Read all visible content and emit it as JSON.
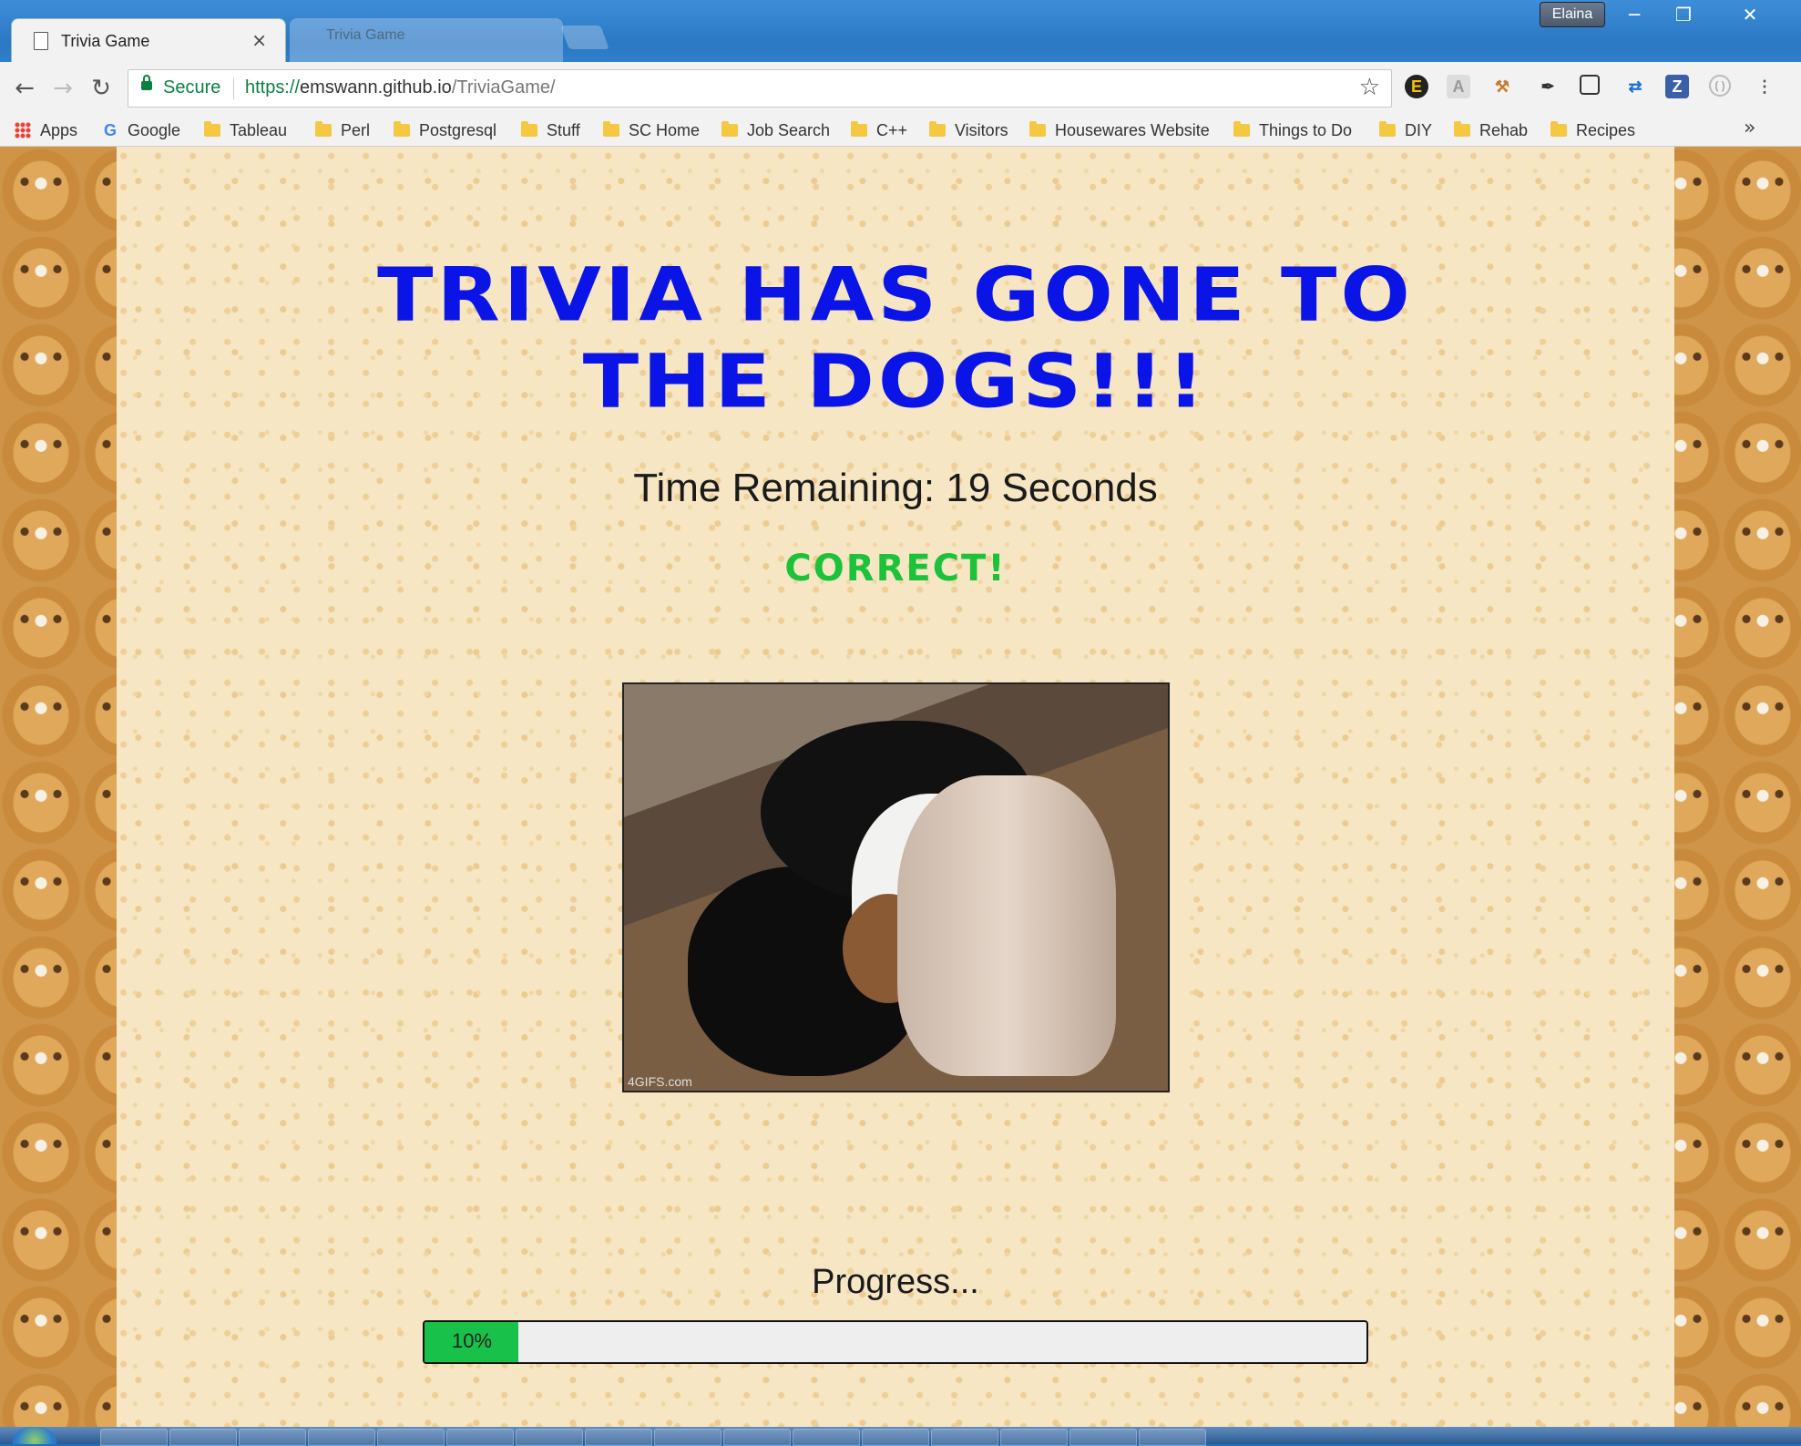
{
  "window": {
    "user_badge": "Elaina",
    "minimize_icon": "minimize-icon",
    "maximize_icon": "maximize-icon",
    "close_icon": "close-icon"
  },
  "tabs": [
    {
      "title": "Trivia Game",
      "active": true
    },
    {
      "title": "Trivia Game",
      "active": false
    }
  ],
  "toolbar": {
    "secure_label": "Secure",
    "url_scheme": "https://",
    "url_host": "emswann.github.io",
    "url_path": "/TriviaGame/"
  },
  "bookmarks": [
    {
      "label": "Apps",
      "icon": "apps-grid-icon"
    },
    {
      "label": "Google",
      "icon": "google-icon"
    },
    {
      "label": "Tableau",
      "icon": "folder-icon"
    },
    {
      "label": "Perl",
      "icon": "folder-icon"
    },
    {
      "label": "Postgresql",
      "icon": "folder-icon"
    },
    {
      "label": "Stuff",
      "icon": "folder-icon"
    },
    {
      "label": "SC Home",
      "icon": "folder-icon"
    },
    {
      "label": "Job Search",
      "icon": "folder-icon"
    },
    {
      "label": "C++",
      "icon": "folder-icon"
    },
    {
      "label": "Visitors",
      "icon": "folder-icon"
    },
    {
      "label": "Housewares Website",
      "icon": "folder-icon"
    },
    {
      "label": "Things to Do",
      "icon": "folder-icon"
    },
    {
      "label": "DIY",
      "icon": "folder-icon"
    },
    {
      "label": "Rehab",
      "icon": "folder-icon"
    },
    {
      "label": "Recipes",
      "icon": "folder-icon"
    }
  ],
  "page": {
    "title": "Trivia Has Gone To The Dogs!!!",
    "time_remaining": "Time Remaining: 19 Seconds",
    "result": "Correct!",
    "gif_watermark": "4GIFS.com",
    "progress_label": "Progress...",
    "progress_text": "10%",
    "progress_fraction": 0.1
  },
  "colors": {
    "title": "#0a14e6",
    "result": "#1bc23a",
    "progress_fill": "#18c24a",
    "secure": "#0b8043"
  }
}
